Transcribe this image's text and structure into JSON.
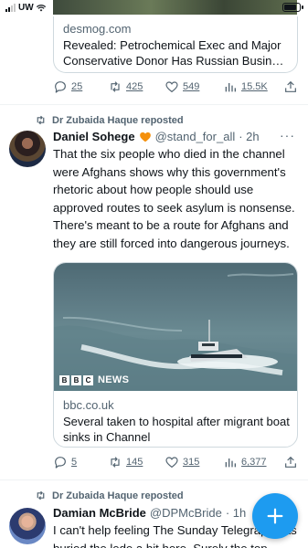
{
  "status_bar": {
    "carrier": "UW",
    "time": "23:45"
  },
  "tweet1": {
    "link_card": {
      "domain": "desmog.com",
      "title": "Revealed: Petrochemical Exec and Major Conservative Donor Has Russian Busin…"
    },
    "actions": {
      "replies": "25",
      "reposts": "425",
      "likes": "549",
      "views": "15.5K"
    }
  },
  "tweet2": {
    "repost_label": "Dr Zubaida Haque reposted",
    "author_name": "Daniel Sohege",
    "handle": "@stand_for_all",
    "time": "· 2h",
    "more": "···",
    "text": "That the six people who died in the channel were Afghans shows why this government's rhetoric about how people should use approved routes to seek asylum is nonsense. There's meant to be a route for Afghans and they are still forced into dangerous journeys.",
    "media_card": {
      "brand_letters": [
        "B",
        "B",
        "C"
      ],
      "brand_word": "NEWS",
      "domain": "bbc.co.uk",
      "title": "Several taken to hospital after migrant boat sinks in Channel"
    },
    "actions": {
      "replies": "5",
      "reposts": "145",
      "likes": "315",
      "views": "6,377"
    }
  },
  "tweet3": {
    "repost_label": "Dr Zubaida Haque reposted",
    "author_name": "Damian McBride",
    "handle": "@DPMcBride",
    "time": "· 1h",
    "text": "I can't help feeling The Sunday Telegraph has buried the lede a bit here. Surely the top"
  },
  "colors": {
    "accent": "#1d9bf0",
    "text": "#0f1419",
    "muted": "#536471",
    "border": "#cfd9de",
    "badge": "#f4900c"
  },
  "icons": [
    "reply-icon",
    "repost-icon",
    "like-icon",
    "views-icon",
    "share-icon",
    "compose-icon",
    "heart-badge-icon"
  ]
}
